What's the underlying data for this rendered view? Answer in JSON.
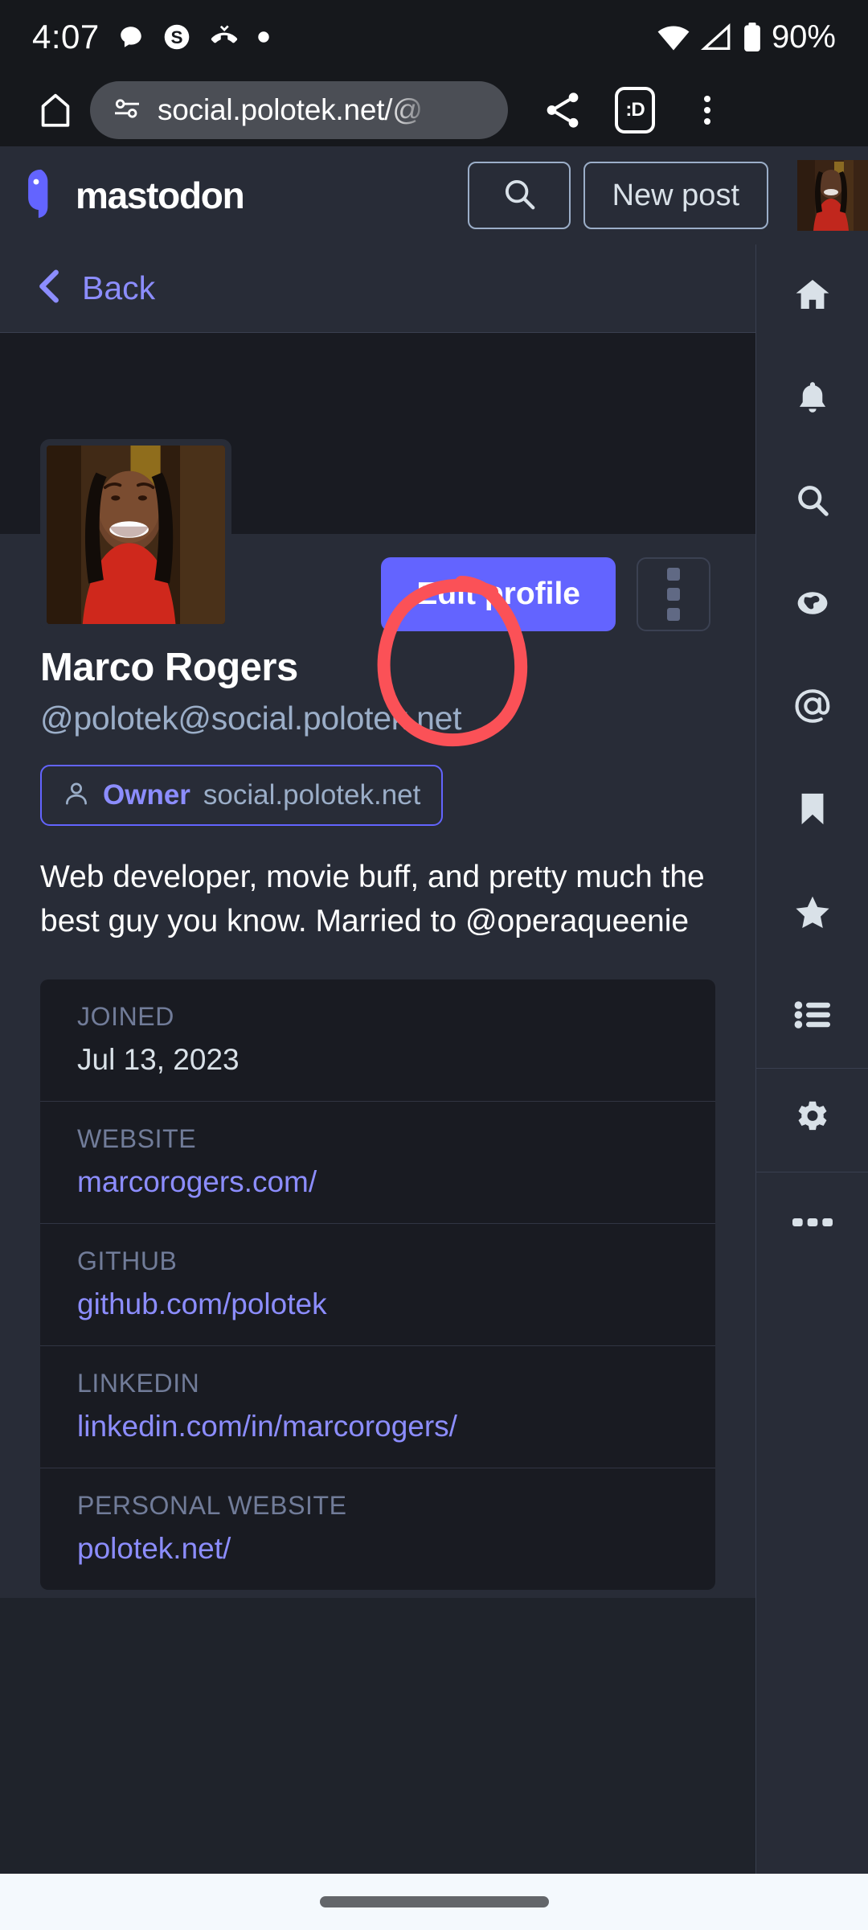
{
  "status_bar": {
    "time": "4:07",
    "battery_percent": "90%",
    "icons": [
      "chat-bubble-icon",
      "skype-icon",
      "missed-call-icon",
      "dot-icon"
    ],
    "right_icons": [
      "wifi-icon",
      "cellular-signal-icon",
      "battery-icon"
    ]
  },
  "browser": {
    "url": "social.polotek.net/@",
    "home_label": "home-icon",
    "tab_count": ":D",
    "buttons": [
      "home-button",
      "share-button",
      "tabs-button",
      "menu-button"
    ]
  },
  "app_header": {
    "logo_text": "mastodon",
    "search_label": "search-icon",
    "new_post_label": "New post",
    "avatar_label": "account-avatar"
  },
  "back_bar": {
    "label": "Back"
  },
  "profile": {
    "display_name": "Marco Rogers",
    "handle": "@polotek@social.polotek.net",
    "role_badge": {
      "role": "Owner",
      "domain": "social.polotek.net"
    },
    "bio": "Web developer, movie buff, and pretty much the best guy you know. Married to @operaqueenie",
    "actions": {
      "edit_profile": "Edit profile",
      "more_options": "more-options-icon"
    },
    "metadata": [
      {
        "label": "Joined",
        "value": "Jul 13, 2023",
        "is_link": false
      },
      {
        "label": "Website",
        "value": "marcorogers.com/",
        "is_link": true
      },
      {
        "label": "Github",
        "value": "github.com/polotek",
        "is_link": true
      },
      {
        "label": "Linkedin",
        "value": "linkedin.com/in/marcorogers/",
        "is_link": true
      },
      {
        "label": "Personal website",
        "value": "polotek.net/",
        "is_link": true
      }
    ]
  },
  "right_rail": {
    "items": [
      {
        "name": "home",
        "icon": "home-icon"
      },
      {
        "name": "notifications",
        "icon": "bell-icon"
      },
      {
        "name": "search",
        "icon": "search-icon"
      },
      {
        "name": "explore",
        "icon": "globe-icon"
      },
      {
        "name": "mentions",
        "icon": "at-icon"
      },
      {
        "name": "bookmarks",
        "icon": "bookmark-icon"
      },
      {
        "name": "favourites",
        "icon": "star-icon"
      },
      {
        "name": "lists",
        "icon": "list-icon"
      },
      {
        "name": "preferences",
        "icon": "gear-icon"
      },
      {
        "name": "more",
        "icon": "ellipsis-icon"
      }
    ]
  },
  "annotation": {
    "shape": "red-circle-highlight",
    "color": "#fb5157",
    "target": "more-options-button"
  },
  "colors": {
    "accent": "#6364ff",
    "link": "#8c8dff",
    "panel": "#282c37",
    "page": "#1f232b",
    "inset": "#191b22",
    "muted": "#9baec8",
    "annotation": "#fb5157"
  }
}
